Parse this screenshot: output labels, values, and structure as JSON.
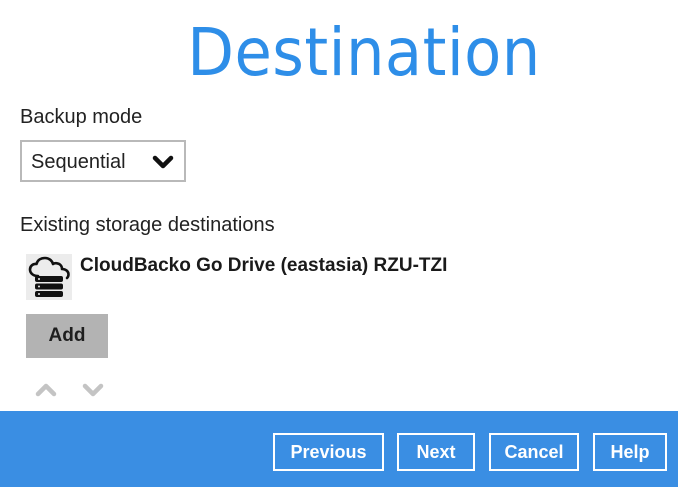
{
  "page": {
    "title": "Destination"
  },
  "backup_mode": {
    "label": "Backup mode",
    "selected": "Sequential",
    "chevron_icon": "chevron-down-icon"
  },
  "storage": {
    "label": "Existing storage destinations",
    "destinations": [
      {
        "name": "CloudBacko Go Drive (eastasia) RZU-TZI",
        "icon": "cloud-storage-icon"
      }
    ],
    "add_label": "Add",
    "move_up_icon": "chevron-up-icon",
    "move_down_icon": "chevron-down-icon"
  },
  "footer": {
    "previous_label": "Previous",
    "next_label": "Next",
    "cancel_label": "Cancel",
    "help_label": "Help"
  },
  "colors": {
    "accent": "#2e8ee8",
    "footer_bg": "#3a8ee3",
    "add_button_bg": "#b3b3b3",
    "disabled_arrow": "#c4c4c4"
  }
}
